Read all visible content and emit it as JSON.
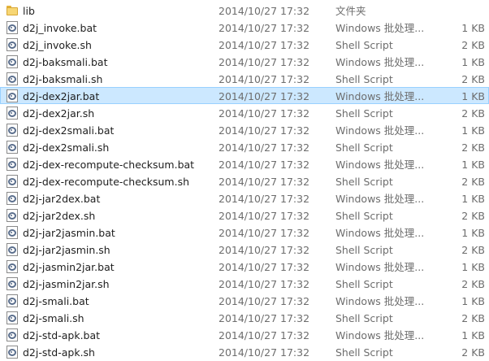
{
  "files": [
    {
      "name": "lib",
      "date": "2014/10/27 17:32",
      "type": "文件夹",
      "size": "",
      "icon": "folder-icon",
      "selected": false
    },
    {
      "name": "d2j_invoke.bat",
      "date": "2014/10/27 17:32",
      "type": "Windows 批处理...",
      "size": "1 KB",
      "icon": "script-file-icon",
      "selected": false
    },
    {
      "name": "d2j_invoke.sh",
      "date": "2014/10/27 17:32",
      "type": "Shell Script",
      "size": "2 KB",
      "icon": "script-file-icon",
      "selected": false
    },
    {
      "name": "d2j-baksmali.bat",
      "date": "2014/10/27 17:32",
      "type": "Windows 批处理...",
      "size": "1 KB",
      "icon": "script-file-icon",
      "selected": false
    },
    {
      "name": "d2j-baksmali.sh",
      "date": "2014/10/27 17:32",
      "type": "Shell Script",
      "size": "2 KB",
      "icon": "script-file-icon",
      "selected": false
    },
    {
      "name": "d2j-dex2jar.bat",
      "date": "2014/10/27 17:32",
      "type": "Windows 批处理...",
      "size": "1 KB",
      "icon": "script-file-icon",
      "selected": true
    },
    {
      "name": "d2j-dex2jar.sh",
      "date": "2014/10/27 17:32",
      "type": "Shell Script",
      "size": "2 KB",
      "icon": "script-file-icon",
      "selected": false
    },
    {
      "name": "d2j-dex2smali.bat",
      "date": "2014/10/27 17:32",
      "type": "Windows 批处理...",
      "size": "1 KB",
      "icon": "script-file-icon",
      "selected": false
    },
    {
      "name": "d2j-dex2smali.sh",
      "date": "2014/10/27 17:32",
      "type": "Shell Script",
      "size": "2 KB",
      "icon": "script-file-icon",
      "selected": false
    },
    {
      "name": "d2j-dex-recompute-checksum.bat",
      "date": "2014/10/27 17:32",
      "type": "Windows 批处理...",
      "size": "1 KB",
      "icon": "script-file-icon",
      "selected": false
    },
    {
      "name": "d2j-dex-recompute-checksum.sh",
      "date": "2014/10/27 17:32",
      "type": "Shell Script",
      "size": "2 KB",
      "icon": "script-file-icon",
      "selected": false
    },
    {
      "name": "d2j-jar2dex.bat",
      "date": "2014/10/27 17:32",
      "type": "Windows 批处理...",
      "size": "1 KB",
      "icon": "script-file-icon",
      "selected": false
    },
    {
      "name": "d2j-jar2dex.sh",
      "date": "2014/10/27 17:32",
      "type": "Shell Script",
      "size": "2 KB",
      "icon": "script-file-icon",
      "selected": false
    },
    {
      "name": "d2j-jar2jasmin.bat",
      "date": "2014/10/27 17:32",
      "type": "Windows 批处理...",
      "size": "1 KB",
      "icon": "script-file-icon",
      "selected": false
    },
    {
      "name": "d2j-jar2jasmin.sh",
      "date": "2014/10/27 17:32",
      "type": "Shell Script",
      "size": "2 KB",
      "icon": "script-file-icon",
      "selected": false
    },
    {
      "name": "d2j-jasmin2jar.bat",
      "date": "2014/10/27 17:32",
      "type": "Windows 批处理...",
      "size": "1 KB",
      "icon": "script-file-icon",
      "selected": false
    },
    {
      "name": "d2j-jasmin2jar.sh",
      "date": "2014/10/27 17:32",
      "type": "Shell Script",
      "size": "2 KB",
      "icon": "script-file-icon",
      "selected": false
    },
    {
      "name": "d2j-smali.bat",
      "date": "2014/10/27 17:32",
      "type": "Windows 批处理...",
      "size": "1 KB",
      "icon": "script-file-icon",
      "selected": false
    },
    {
      "name": "d2j-smali.sh",
      "date": "2014/10/27 17:32",
      "type": "Shell Script",
      "size": "2 KB",
      "icon": "script-file-icon",
      "selected": false
    },
    {
      "name": "d2j-std-apk.bat",
      "date": "2014/10/27 17:32",
      "type": "Windows 批处理...",
      "size": "1 KB",
      "icon": "script-file-icon",
      "selected": false
    },
    {
      "name": "d2j-std-apk.sh",
      "date": "2014/10/27 17:32",
      "type": "Shell Script",
      "size": "2 KB",
      "icon": "script-file-icon",
      "selected": false
    }
  ],
  "colors": {
    "selection_background": "#cce8ff",
    "selection_border": "#99d1ff",
    "name_text": "#1e1e1e",
    "detail_text": "#6d6d6d",
    "folder": "#f7d674"
  }
}
